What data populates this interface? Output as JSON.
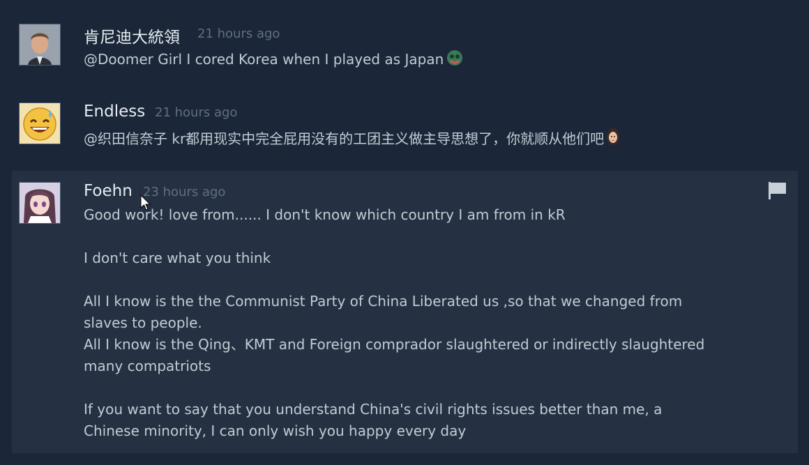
{
  "comments": [
    {
      "author": "肯尼迪大統領",
      "time": "21 hours ago",
      "text": "@Doomer Girl I cored Korea when I played as Japan"
    },
    {
      "author": "Endless",
      "time": "21 hours ago",
      "text": "@织田信奈子 kr都用现实中完全屁用没有的工团主义做主导思想了，你就顺从他们吧"
    },
    {
      "author": "Foehn",
      "time": "23 hours ago",
      "lines": [
        "Good work! love from...... I don't know which country I am from in kR",
        "",
        "I don't care what you think",
        "",
        "All I know is the the Communist Party of China Liberated us ,so that we changed from",
        "slaves to people.",
        "All I know is the Qing、KMT and Foreign comprador slaughtered or indirectly slaughtered",
        "many compatriots",
        "",
        "If you want to say that you understand China's civil rights issues better than me, a",
        "Chinese minority, I can only wish you happy every day"
      ]
    }
  ]
}
